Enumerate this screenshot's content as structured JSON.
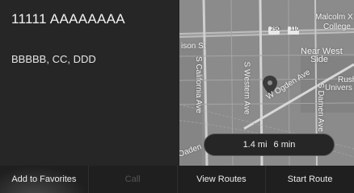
{
  "destination": {
    "title": "11111 AAAAAAAA",
    "address": "BBBBB, CC, DDD"
  },
  "map": {
    "labels": {
      "malcolm": "Malcolm X",
      "college": "College",
      "highway_290": "290",
      "highway_110": "110",
      "ison_st": "ison St",
      "california": "S California Ave",
      "western": "S Western Ave",
      "near_west": "Near West",
      "side": "Side",
      "ogden": "W Ogden Ave",
      "rush": "Rush",
      "univers": "Univers",
      "damen": "S Damen Ave",
      "oaden": "Oaden"
    }
  },
  "route": {
    "distance": "1.4 mi",
    "time": "6 min"
  },
  "actions": {
    "add_favorites": "Add to Favorites",
    "call": "Call",
    "view_routes": "View Routes",
    "start_route": "Start Route"
  }
}
